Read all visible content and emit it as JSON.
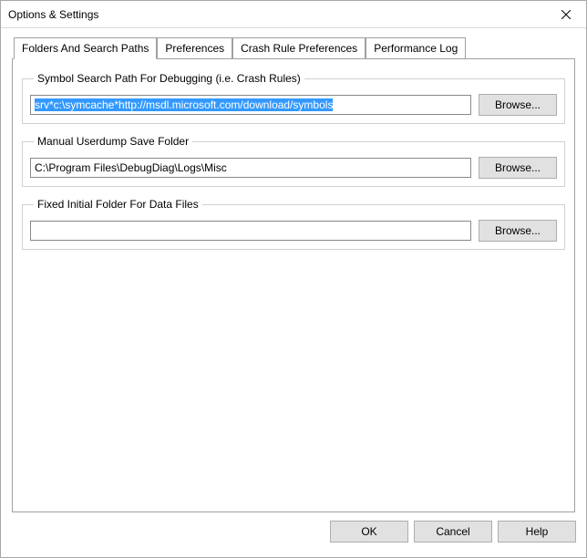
{
  "window": {
    "title": "Options & Settings"
  },
  "tabs": {
    "items": [
      {
        "label": "Folders And Search Paths"
      },
      {
        "label": "Preferences"
      },
      {
        "label": "Crash Rule Preferences"
      },
      {
        "label": "Performance Log"
      }
    ]
  },
  "groups": {
    "symbol": {
      "legend": "Symbol Search Path For Debugging   (i.e. Crash Rules)",
      "value": "srv*c:\\symcache*http://msdl.microsoft.com/download/symbols",
      "browse": "Browse..."
    },
    "userdump": {
      "legend": "Manual Userdump Save Folder",
      "value": "C:\\Program Files\\DebugDiag\\Logs\\Misc",
      "browse": "Browse..."
    },
    "datafiles": {
      "legend": "Fixed Initial Folder For Data Files",
      "value": "",
      "browse": "Browse..."
    }
  },
  "footer": {
    "ok": "OK",
    "cancel": "Cancel",
    "help": "Help"
  }
}
